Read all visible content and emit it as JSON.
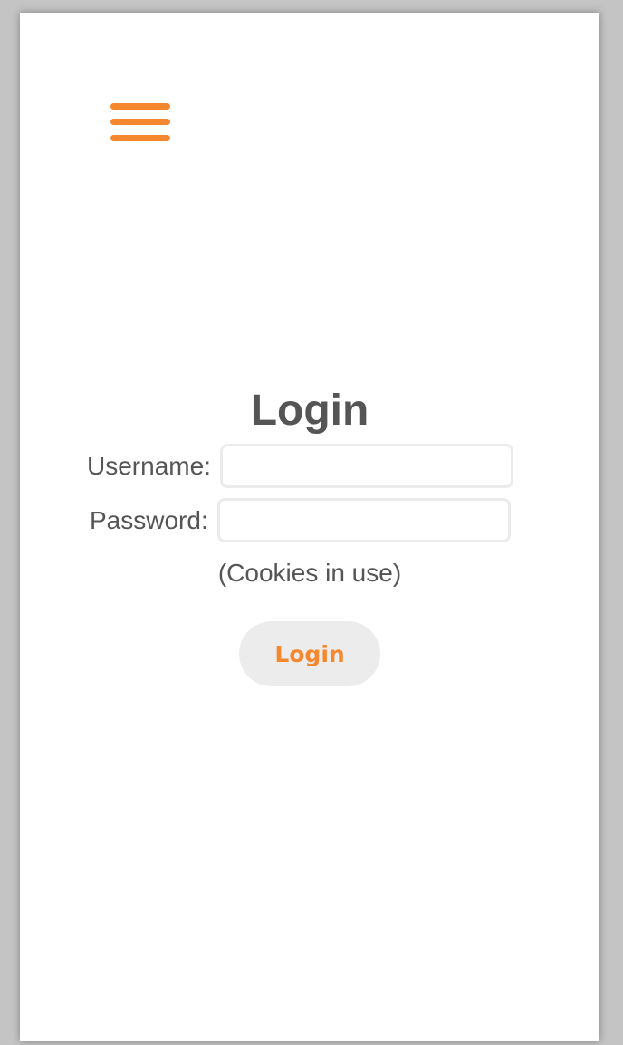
{
  "colors": {
    "accent": "#f5882f",
    "text": "#555555",
    "button_bg": "#ececec"
  },
  "nav": {
    "menu_icon": "hamburger-icon"
  },
  "form": {
    "title": "Login",
    "username_label": "Username:",
    "username_value": "",
    "password_label": "Password:",
    "password_value": "",
    "cookies_note": "(Cookies in use)",
    "submit_label": "Login"
  }
}
